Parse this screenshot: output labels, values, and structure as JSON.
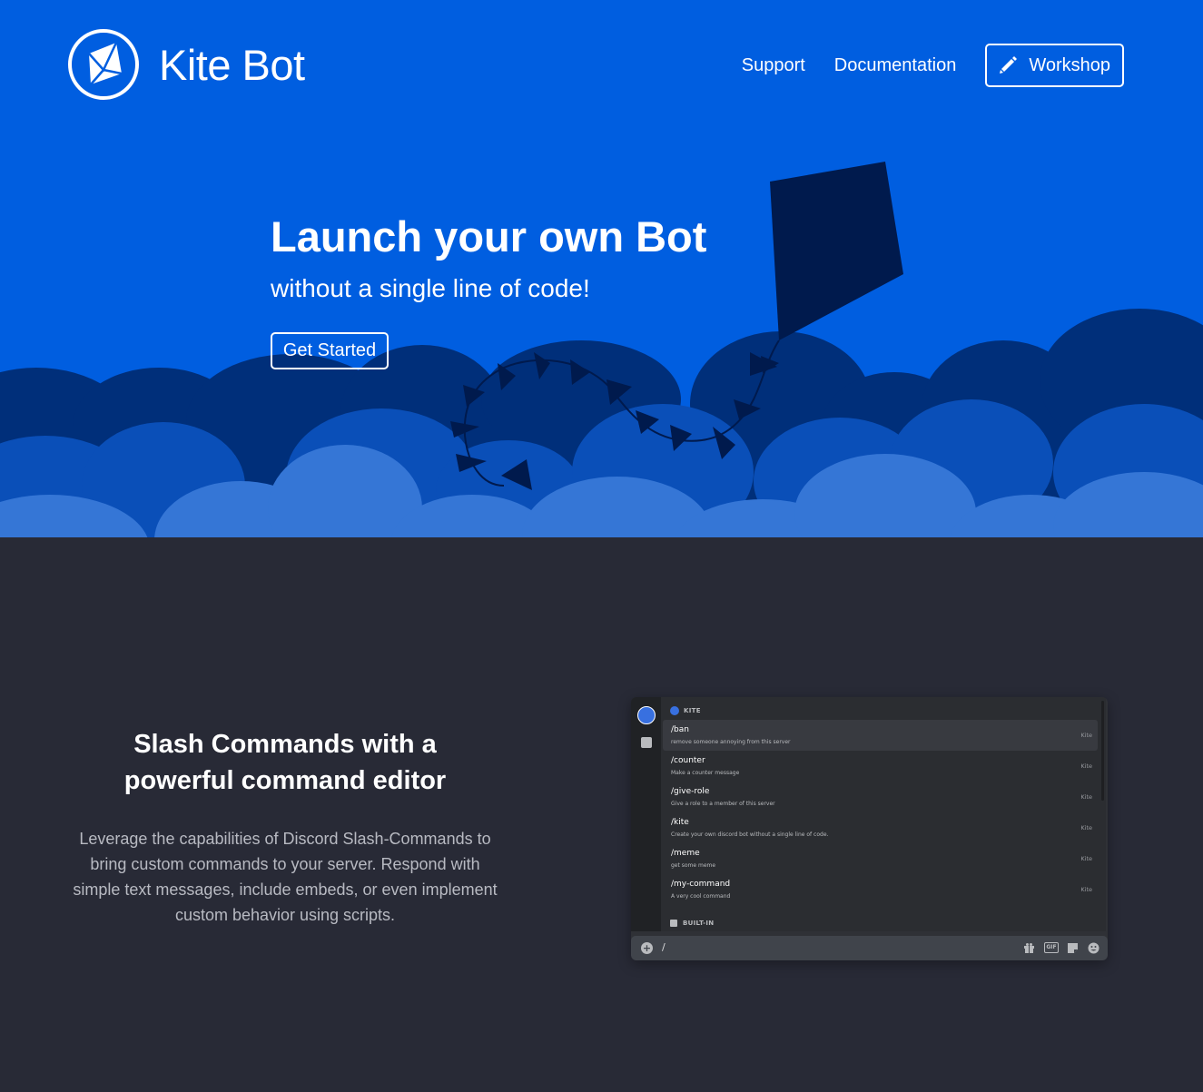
{
  "header": {
    "brand_name": "Kite Bot",
    "nav": {
      "support": "Support",
      "documentation": "Documentation",
      "workshop": "Workshop"
    }
  },
  "hero": {
    "headline": "Launch your own Bot",
    "subheadline": "without a single line of code!",
    "cta_label": "Get Started"
  },
  "feature": {
    "title_line1": "Slash Commands with a",
    "title_line2": "powerful command editor",
    "description": "Leverage the capabilities of Discord Slash-Commands to bring custom commands to your server. Respond with simple text messages, include embeds, or even implement custom behavior using scripts."
  },
  "discord_preview": {
    "group_label": "KITE",
    "builtin_label": "BUILT-IN",
    "typed_input": "/",
    "commands": [
      {
        "name": "/ban",
        "description": "remove someone annoying from this server",
        "source": "Kite"
      },
      {
        "name": "/counter",
        "description": "Make a counter message",
        "source": "Kite"
      },
      {
        "name": "/give-role",
        "description": "Give a role to a member of this server",
        "source": "Kite"
      },
      {
        "name": "/kite",
        "description": "Create your own discord bot without a single line of code.",
        "source": "Kite"
      },
      {
        "name": "/meme",
        "description": "get some meme",
        "source": "Kite"
      },
      {
        "name": "/my-command",
        "description": "A very cool command",
        "source": "Kite"
      }
    ],
    "toolbar_icons": [
      "gift-icon",
      "gif-icon",
      "sticker-icon",
      "emoji-icon"
    ],
    "gif_label": "GIF"
  },
  "colors": {
    "hero_bg": "#005ee0",
    "cloud_dark": "#002f7a",
    "cloud_mid": "#0a4fb8",
    "cloud_light": "#3576d6",
    "kite": "#001a4d",
    "page_bg": "#282a36"
  }
}
